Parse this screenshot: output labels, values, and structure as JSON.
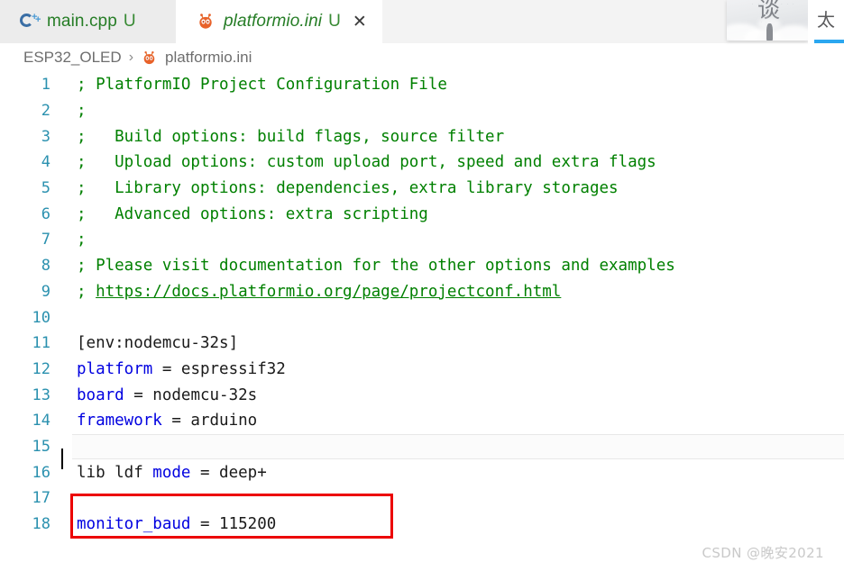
{
  "tabs": [
    {
      "label": "main.cpp",
      "dirty_badge": "U",
      "icon": "cpp-file-icon",
      "active": false,
      "closable": false
    },
    {
      "label": "platformio.ini",
      "dirty_badge": "U",
      "icon": "platformio-alien-icon",
      "active": true,
      "closable": true,
      "close_glyph": "✕"
    }
  ],
  "breadcrumb": {
    "project": "ESP32_OLED",
    "separator": "›",
    "file": "platformio.ini",
    "file_icon": "platformio-alien-icon"
  },
  "editor": {
    "language": "ini",
    "current_line": 15,
    "lines": [
      {
        "n": "1",
        "segments": [
          {
            "t": "; PlatformIO Project Configuration File",
            "c": "cmt"
          }
        ]
      },
      {
        "n": "2",
        "segments": [
          {
            "t": ";",
            "c": "cmt"
          }
        ]
      },
      {
        "n": "3",
        "segments": [
          {
            "t": ";   Build options: build flags, source filter",
            "c": "cmt"
          }
        ]
      },
      {
        "n": "4",
        "segments": [
          {
            "t": ";   Upload options: custom upload port, speed and extra flags",
            "c": "cmt"
          }
        ]
      },
      {
        "n": "5",
        "segments": [
          {
            "t": ";   Library options: dependencies, extra library storages",
            "c": "cmt"
          }
        ]
      },
      {
        "n": "6",
        "segments": [
          {
            "t": ";   Advanced options: extra scripting",
            "c": "cmt"
          }
        ]
      },
      {
        "n": "7",
        "segments": [
          {
            "t": ";",
            "c": "cmt"
          }
        ]
      },
      {
        "n": "8",
        "segments": [
          {
            "t": "; Please visit documentation for the other options and examples",
            "c": "cmt"
          }
        ]
      },
      {
        "n": "9",
        "segments": [
          {
            "t": "; ",
            "c": "cmt"
          },
          {
            "t": "https://docs.platformio.org/page/projectconf.html",
            "c": "lnk"
          }
        ]
      },
      {
        "n": "10",
        "segments": [
          {
            "t": "",
            "c": ""
          }
        ]
      },
      {
        "n": "11",
        "segments": [
          {
            "t": "[env:nodemcu-32s]",
            "c": ""
          }
        ]
      },
      {
        "n": "12",
        "segments": [
          {
            "t": "platform",
            "c": "key"
          },
          {
            "t": " = espressif32",
            "c": ""
          }
        ]
      },
      {
        "n": "13",
        "segments": [
          {
            "t": "board",
            "c": "key"
          },
          {
            "t": " = nodemcu-32s",
            "c": ""
          }
        ]
      },
      {
        "n": "14",
        "segments": [
          {
            "t": "framework",
            "c": "key"
          },
          {
            "t": " = arduino",
            "c": ""
          }
        ]
      },
      {
        "n": "15",
        "segments": [
          {
            "t": "",
            "c": ""
          }
        ]
      },
      {
        "n": "16",
        "segments": [
          {
            "t": "lib ldf ",
            "c": ""
          },
          {
            "t": "mode",
            "c": "key"
          },
          {
            "t": " = deep+",
            "c": ""
          }
        ]
      },
      {
        "n": "17",
        "segments": [
          {
            "t": "",
            "c": ""
          }
        ]
      },
      {
        "n": "18",
        "segments": [
          {
            "t": "monitor_baud",
            "c": "key"
          },
          {
            "t": " = 115200",
            "c": ""
          }
        ]
      }
    ]
  },
  "annotation": {
    "shape": "rectangle",
    "color": "#ec0000",
    "covers_lines": "17-18"
  },
  "overlay": {
    "tab_glyph": "太",
    "thumbnail_glyph": "谈",
    "underline_color": "#2ba7f0"
  },
  "watermark": {
    "text": "CSDN @晚安2021"
  },
  "colors": {
    "comment": "#008000",
    "keyword": "#0000e0",
    "line_number": "#2b91af",
    "tab_text": "#267d26",
    "dirty_badge": "#388a34",
    "annotation": "#ec0000",
    "tabbar_bg": "#f3f3f3",
    "inactive_tab_bg": "#ececec"
  }
}
